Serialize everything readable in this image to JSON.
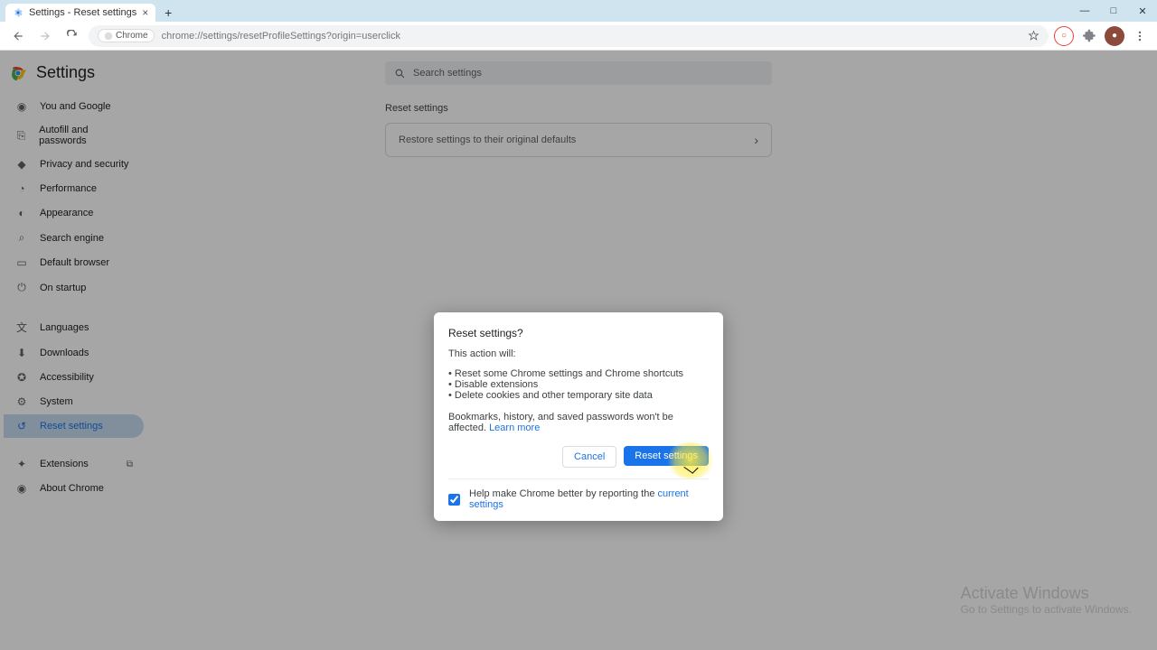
{
  "window": {
    "tab_title": "Settings - Reset settings",
    "minimize": "—",
    "maximize": "□",
    "close": "✕"
  },
  "toolbar": {
    "chip": "Chrome",
    "url": "chrome://settings/resetProfileSettings?origin=userclick"
  },
  "header": {
    "title": "Settings"
  },
  "search": {
    "placeholder": "Search settings"
  },
  "sidebar": {
    "items": [
      {
        "label": "You and Google"
      },
      {
        "label": "Autofill and passwords"
      },
      {
        "label": "Privacy and security"
      },
      {
        "label": "Performance"
      },
      {
        "label": "Appearance"
      },
      {
        "label": "Search engine"
      },
      {
        "label": "Default browser"
      },
      {
        "label": "On startup"
      },
      {
        "label": "Languages"
      },
      {
        "label": "Downloads"
      },
      {
        "label": "Accessibility"
      },
      {
        "label": "System"
      },
      {
        "label": "Reset settings"
      },
      {
        "label": "Extensions"
      },
      {
        "label": "About Chrome"
      }
    ]
  },
  "main": {
    "section_title": "Reset settings",
    "row_label": "Restore settings to their original defaults"
  },
  "dialog": {
    "title": "Reset settings?",
    "intro": "This action will:",
    "bullets": [
      "Reset some Chrome settings and Chrome shortcuts",
      "Disable extensions",
      "Delete cookies and other temporary site data"
    ],
    "note_prefix": "Bookmarks, history, and saved passwords won't be affected. ",
    "learn_more": "Learn more",
    "cancel": "Cancel",
    "confirm": "Reset settings",
    "help_prefix": "Help make Chrome better by reporting the ",
    "help_link": "current settings"
  },
  "activate": {
    "line1": "Activate Windows",
    "line2": "Go to Settings to activate Windows."
  }
}
